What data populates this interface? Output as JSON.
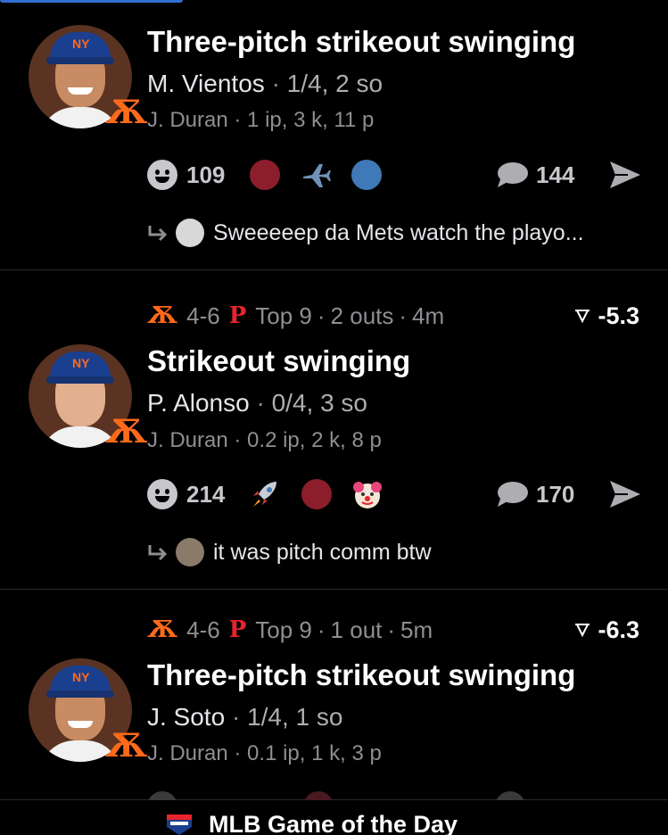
{
  "feed": [
    {
      "title": "Three-pitch strikeout swinging",
      "batter_name": "M. Vientos",
      "batter_stat": "1/4, 2 so",
      "pitcher_name": "J. Duran",
      "pitcher_stat": "1 ip, 3 k, 11 p",
      "reaction_count": "109",
      "comment_count": "144",
      "reaction_icons": [
        "red-circle-icon",
        "airplane-icon",
        "blue-circle-icon"
      ],
      "reply_text": "Sweeeeep da Mets watch the playo..."
    },
    {
      "team_away": "4-6",
      "inning": "Top 9",
      "outs": "2 outs",
      "time": "4m",
      "win_prob_change": "-5.3",
      "title": "Strikeout swinging",
      "batter_name": "P. Alonso",
      "batter_stat": "0/4, 3 so",
      "pitcher_name": "J. Duran",
      "pitcher_stat": "0.2 ip, 2 k, 8 p",
      "reaction_count": "214",
      "comment_count": "170",
      "reaction_icons": [
        "rocket-icon",
        "red-circle-icon",
        "clown-icon"
      ],
      "reply_text": "it was pitch comm btw"
    },
    {
      "team_away": "4-6",
      "inning": "Top 9",
      "outs": "1 out",
      "time": "5m",
      "win_prob_change": "-6.3",
      "title": "Three-pitch strikeout swinging",
      "batter_name": "J. Soto",
      "batter_stat": "1/4, 1 so",
      "pitcher_name": "J. Duran",
      "pitcher_stat": "0.1 ip, 1 k, 3 p"
    }
  ],
  "separator": "·",
  "footer": {
    "title": "MLB Game of the Day"
  },
  "colors": {
    "mets_orange": "#ff6a1a",
    "phillies_red": "#e8242b",
    "dark_red": "#8b1e2a",
    "blue_dot": "#3f79b8",
    "background": "#000000"
  }
}
